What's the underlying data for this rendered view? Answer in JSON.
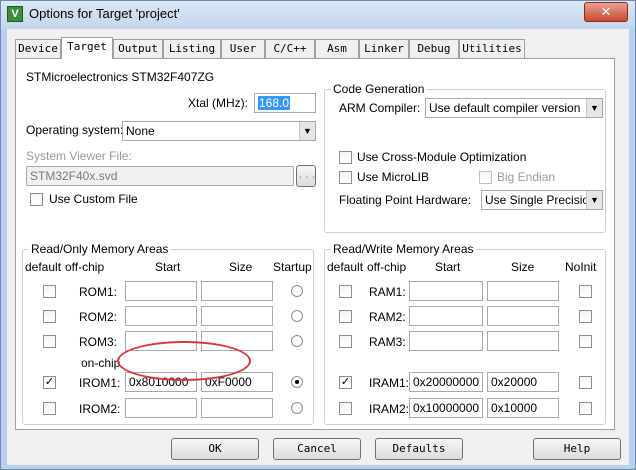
{
  "window": {
    "title": "Options for Target 'project'",
    "app_icon_glyph": "V",
    "close_glyph": "✕"
  },
  "tabs": [
    "Device",
    "Target",
    "Output",
    "Listing",
    "User",
    "C/C++",
    "Asm",
    "Linker",
    "Debug",
    "Utilities"
  ],
  "active_tab": "Target",
  "device": {
    "name": "STMicroelectronics STM32F407ZG"
  },
  "xtal": {
    "label": "Xtal (MHz):",
    "value": "168.0"
  },
  "os": {
    "label": "Operating system:",
    "value": "None"
  },
  "svd": {
    "label": "System Viewer File:",
    "value": "STM32F40x.svd",
    "browse": "..."
  },
  "custom_file": {
    "label": "Use Custom File"
  },
  "codegen": {
    "group_label": "Code Generation",
    "compiler_label": "ARM Compiler:",
    "compiler_value": "Use default compiler version",
    "cross_module": "Use Cross-Module Optimization",
    "microlib": "Use MicroLIB",
    "big_endian": "Big Endian",
    "fpu_label": "Floating Point Hardware:",
    "fpu_value": "Use Single Precision"
  },
  "rom": {
    "group_label": "Read/Only Memory Areas",
    "headers": {
      "default": "default",
      "offchip": "off-chip",
      "start": "Start",
      "size": "Size",
      "startup": "Startup"
    },
    "onchip_label": "on-chip",
    "rows": [
      {
        "label": "ROM1:",
        "start": "",
        "size": "",
        "default": false,
        "startup": false
      },
      {
        "label": "ROM2:",
        "start": "",
        "size": "",
        "default": false,
        "startup": false
      },
      {
        "label": "ROM3:",
        "start": "",
        "size": "",
        "default": false,
        "startup": false
      },
      {
        "label": "IROM1:",
        "start": "0x8010000",
        "size": "0xF0000",
        "default": true,
        "startup": true
      },
      {
        "label": "IROM2:",
        "start": "",
        "size": "",
        "default": false,
        "startup": false
      }
    ]
  },
  "ram": {
    "group_label": "Read/Write Memory Areas",
    "headers": {
      "default": "default",
      "offchip": "off-chip",
      "start": "Start",
      "size": "Size",
      "noinit": "NoInit"
    },
    "rows": [
      {
        "label": "RAM1:",
        "start": "",
        "size": "",
        "default": false,
        "noinit": false
      },
      {
        "label": "RAM2:",
        "start": "",
        "size": "",
        "default": false,
        "noinit": false
      },
      {
        "label": "RAM3:",
        "start": "",
        "size": "",
        "default": false,
        "noinit": false
      },
      {
        "label": "IRAM1:",
        "start": "0x20000000",
        "size": "0x20000",
        "default": true,
        "noinit": false
      },
      {
        "label": "IRAM2:",
        "start": "0x10000000",
        "size": "0x10000",
        "default": false,
        "noinit": false
      }
    ]
  },
  "buttons": {
    "ok": "OK",
    "cancel": "Cancel",
    "defaults": "Defaults",
    "help": "Help"
  },
  "check_glyph": "✓",
  "annotation_color": "#d9363e"
}
